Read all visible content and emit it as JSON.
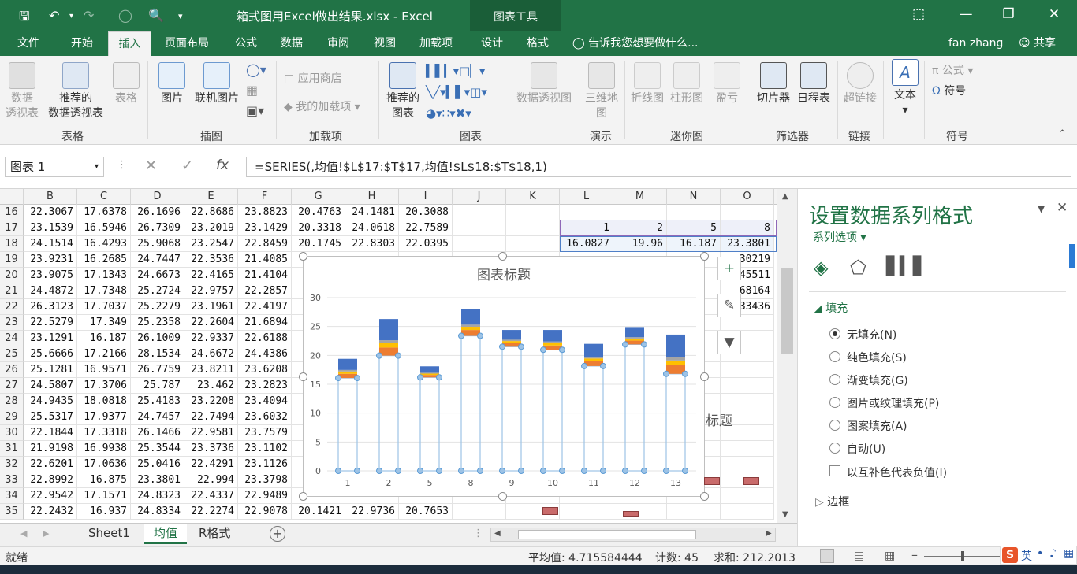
{
  "titlebar": {
    "doc_title": "箱式图用Excel做出结果.xlsx  -  Excel",
    "chart_tools": "图表工具"
  },
  "tabs": [
    {
      "label": "文件"
    },
    {
      "label": "开始"
    },
    {
      "label": "插入"
    },
    {
      "label": "页面布局"
    },
    {
      "label": "公式"
    },
    {
      "label": "数据"
    },
    {
      "label": "审阅"
    },
    {
      "label": "视图"
    },
    {
      "label": "加载项"
    },
    {
      "label": "设计"
    },
    {
      "label": "格式"
    }
  ],
  "tell_me": "告诉我您想要做什么...",
  "user": "fan zhang",
  "share": "共享",
  "ribbon": {
    "btn_pivot": "数据\n透视表",
    "btn_rec_pivot": "推荐的\n数据透视表",
    "btn_table": "表格",
    "btn_picture": "图片",
    "btn_online_pic": "联机图片",
    "btn_store": "应用商店",
    "btn_my_addins": "我的加载项",
    "btn_rec_chart": "推荐的\n图表",
    "btn_pivot_chart": "数据透视图",
    "btn_3d": "三维地\n图",
    "btn_sp_line": "折线图",
    "btn_sp_col": "柱形图",
    "btn_sp_win": "盈亏",
    "btn_slicer": "切片器",
    "btn_timeline": "日程表",
    "btn_link": "超链接",
    "btn_text": "文本",
    "btn_formula": "公式",
    "btn_symbol": "符号",
    "groups": {
      "tables": "表格",
      "illus": "插图",
      "addins": "加载项",
      "charts": "图表",
      "tours": "演示",
      "spark": "迷你图",
      "filters": "筛选器",
      "links": "链接",
      "symbols": "符号"
    }
  },
  "namebox": "图表 1",
  "formula": "=SERIES(,均值!$L$17:$T$17,均值!$L$18:$T$18,1)",
  "columns": [
    "B",
    "C",
    "D",
    "E",
    "F",
    "G",
    "H",
    "I",
    "J",
    "K",
    "L",
    "M",
    "N",
    "O"
  ],
  "rows": [
    {
      "n": "16",
      "v": [
        "22.3067",
        "17.6378",
        "26.1696",
        "22.8686",
        "23.8823",
        "20.4763",
        "24.1481",
        "20.3088"
      ]
    },
    {
      "n": "17",
      "v": [
        "23.1539",
        "16.5946",
        "26.7309",
        "23.2019",
        "23.1429",
        "20.3318",
        "24.0618",
        "22.7589"
      ]
    },
    {
      "n": "18",
      "v": [
        "24.1514",
        "16.4293",
        "25.9068",
        "23.2547",
        "22.8459",
        "20.1745",
        "22.8303",
        "22.0395"
      ]
    },
    {
      "n": "19",
      "v": [
        "23.9231",
        "16.2685",
        "24.7447",
        "22.3536",
        "21.4085",
        "",
        "",
        ""
      ]
    },
    {
      "n": "20",
      "v": [
        "23.9075",
        "17.1343",
        "24.6673",
        "22.4165",
        "21.4104",
        "",
        "",
        ""
      ]
    },
    {
      "n": "21",
      "v": [
        "24.4872",
        "17.7348",
        "25.2724",
        "22.9757",
        "22.2857",
        "",
        "",
        ""
      ]
    },
    {
      "n": "22",
      "v": [
        "26.3123",
        "17.7037",
        "25.2279",
        "23.1961",
        "22.4197",
        "",
        "",
        ""
      ]
    },
    {
      "n": "23",
      "v": [
        "22.5279",
        "17.349",
        "25.2358",
        "22.2604",
        "21.6894",
        "",
        "",
        ""
      ]
    },
    {
      "n": "24",
      "v": [
        "23.1291",
        "16.187",
        "26.1009",
        "22.9337",
        "22.6188",
        "",
        "",
        ""
      ]
    },
    {
      "n": "25",
      "v": [
        "25.6666",
        "17.2166",
        "28.1534",
        "24.6672",
        "24.4386",
        "",
        "",
        ""
      ]
    },
    {
      "n": "26",
      "v": [
        "25.1281",
        "16.9571",
        "26.7759",
        "23.8211",
        "23.6208",
        "",
        "",
        ""
      ]
    },
    {
      "n": "27",
      "v": [
        "24.5807",
        "17.3706",
        "25.787",
        "23.462",
        "23.2823",
        "",
        "",
        ""
      ]
    },
    {
      "n": "28",
      "v": [
        "24.9435",
        "18.0818",
        "25.4183",
        "23.2208",
        "23.4094",
        "",
        "",
        ""
      ]
    },
    {
      "n": "29",
      "v": [
        "25.5317",
        "17.9377",
        "24.7457",
        "22.7494",
        "23.6032",
        "",
        "",
        ""
      ]
    },
    {
      "n": "30",
      "v": [
        "22.1844",
        "17.3318",
        "26.1466",
        "22.9581",
        "23.7579",
        "",
        "",
        ""
      ]
    },
    {
      "n": "31",
      "v": [
        "21.9198",
        "16.9938",
        "25.3544",
        "23.3736",
        "23.1102",
        "",
        "",
        ""
      ]
    },
    {
      "n": "32",
      "v": [
        "22.6201",
        "17.0636",
        "25.0416",
        "22.4291",
        "23.1126",
        "",
        "",
        ""
      ]
    },
    {
      "n": "33",
      "v": [
        "22.8992",
        "16.875",
        "23.3801",
        "22.994",
        "23.3798",
        "",
        "",
        ""
      ]
    },
    {
      "n": "34",
      "v": [
        "22.9542",
        "17.1571",
        "24.8323",
        "22.4337",
        "22.9489",
        "",
        "",
        ""
      ]
    },
    {
      "n": "35",
      "v": [
        "22.2432",
        "16.937",
        "24.8334",
        "22.2274",
        "22.9078",
        "20.1421",
        "22.9736",
        "20.7653"
      ]
    }
  ],
  "right_cells": {
    "r17": [
      "1",
      "2",
      "5",
      "8"
    ],
    "r18": [
      "16.0827",
      "19.96",
      "16.187",
      "23.3801"
    ],
    "r19": "30219",
    "r20": "45511",
    "r21": "68164",
    "r22": "33436",
    "behind_title": "标题"
  },
  "chart": {
    "title": "图表标题"
  },
  "chart_data": {
    "type": "bar",
    "categories": [
      "1",
      "2",
      "5",
      "8",
      "9",
      "10",
      "11",
      "12",
      "13"
    ],
    "ylim": [
      0,
      30
    ],
    "yticks": [
      0,
      5,
      10,
      15,
      20,
      25,
      30
    ],
    "base": [
      16.08,
      19.96,
      16.19,
      23.38,
      21.5,
      20.96,
      18.15,
      21.9,
      16.8
    ],
    "top": [
      19.4,
      26.3,
      18.1,
      28.0,
      24.4,
      24.4,
      22.0,
      24.9,
      23.6
    ],
    "grid": true
  },
  "sheets": [
    "Sheet1",
    "均值",
    "R格式"
  ],
  "status": {
    "ready": "就绪",
    "avg": "平均值: 4.715584444",
    "count": "计数: 45",
    "sum": "求和: 212.2013"
  },
  "pane": {
    "title": "设置数据系列格式",
    "series_options": "系列选项",
    "fill": "填充",
    "border": "边框",
    "options": [
      "无填充(N)",
      "纯色填充(S)",
      "渐变填充(G)",
      "图片或纹理填充(P)",
      "图案填充(A)",
      "自动(U)"
    ],
    "invert": "以互补色代表负值(I)"
  }
}
